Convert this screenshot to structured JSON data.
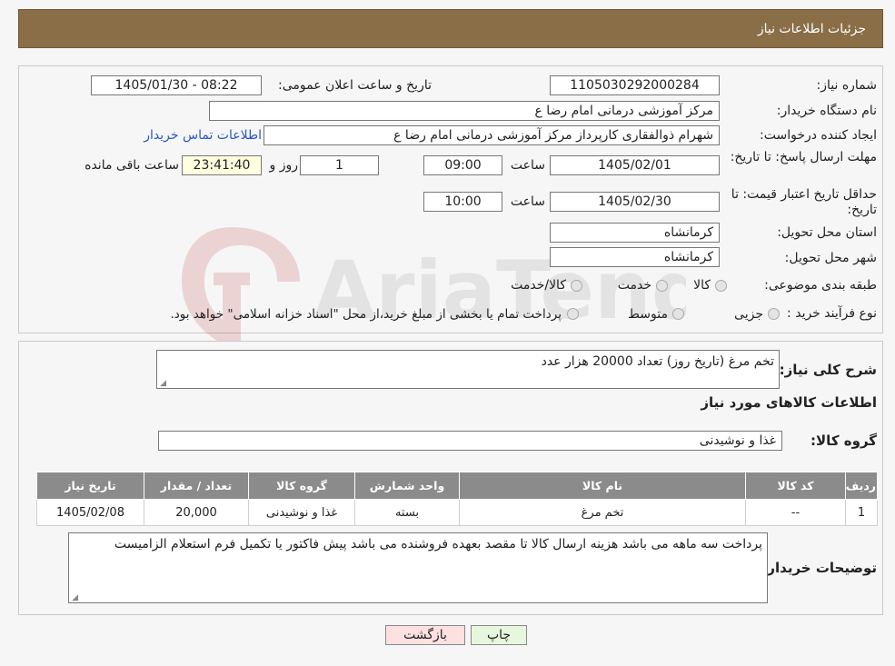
{
  "header": {
    "title": "جزئيات اطلاعات نياز"
  },
  "form": {
    "need_number_label": "شماره نیاز:",
    "need_number": "1105030292000284",
    "announce_label": "تاریخ و ساعت اعلان عمومی:",
    "announce_value": "1405/01/30 - 08:22",
    "buyer_org_label": "نام دستگاه خریدار:",
    "buyer_org": "مرکز آموزشی  درمانی امام رضا  ع",
    "requester_label": "ایجاد کننده درخواست:",
    "requester": "شهرام ذوالفقاری کارپرداز مرکز آموزشی  درمانی امام رضا  ع",
    "contact_link": "اطلاعات تماس خریدار",
    "reply_deadline_label": "مهلت ارسال پاسخ: تا تاریخ:",
    "reply_date": "1405/02/01",
    "time_label": "ساعت",
    "reply_time": "09:00",
    "days_value": "1",
    "days_label": "روز و",
    "remaining_time": "23:41:40",
    "remaining_label": "ساعت باقی مانده",
    "price_validity_label": "حداقل تاریخ اعتبار قیمت: تا تاریخ:",
    "price_date": "1405/02/30",
    "price_time": "10:00",
    "province_label": "استان محل تحویل:",
    "province": "کرمانشاه",
    "city_label": "شهر محل تحویل:",
    "city": "کرمانشاه",
    "category_label": "طبقه بندی موضوعی:",
    "category_options": [
      "کالا",
      "خدمت",
      "کالا/خدمت"
    ],
    "process_label": "نوع فرآیند خرید :",
    "process_options": [
      "جزیی",
      "متوسط"
    ],
    "process_note": "پرداخت تمام یا بخشی از مبلغ خرید،از محل \"اسناد خزانه اسلامی\" خواهد بود."
  },
  "details": {
    "summary_label": "شرح کلی نیاز:",
    "summary": "تخم مرغ (تاریخ روز) تعداد 20000 هزار عدد",
    "goods_title": "اطلاعات کالاهای مورد نیاز",
    "group_label": "گروه کالا:",
    "group_value": "غذا و نوشیدنی",
    "table": {
      "headers": [
        "ردیف",
        "کد کالا",
        "نام کالا",
        "واحد شمارش",
        "گروه کالا",
        "تعداد / مقدار",
        "تاریخ نیاز"
      ],
      "rows": [
        [
          "1",
          "--",
          "تخم مرغ",
          "بسته",
          "غذا و نوشیدنی",
          "20,000",
          "1405/02/08"
        ]
      ]
    },
    "buyer_notes_label": "توضیحات خریدار:",
    "buyer_notes": "پرداخت سه ماهه می باشد هزینه ارسال کالا تا مقصد بعهده فروشنده می باشد پیش فاکتور یا تکمیل فرم استعلام الزامیست"
  },
  "buttons": {
    "print": "چاپ",
    "back": "بازگشت"
  },
  "colors": {
    "header_bg": "#8a6e47",
    "table_header_bg": "#8b8b8b",
    "link": "#2a55c8",
    "back_btn_bg": "#fde0e0",
    "print_btn_bg": "#e6f7de"
  }
}
